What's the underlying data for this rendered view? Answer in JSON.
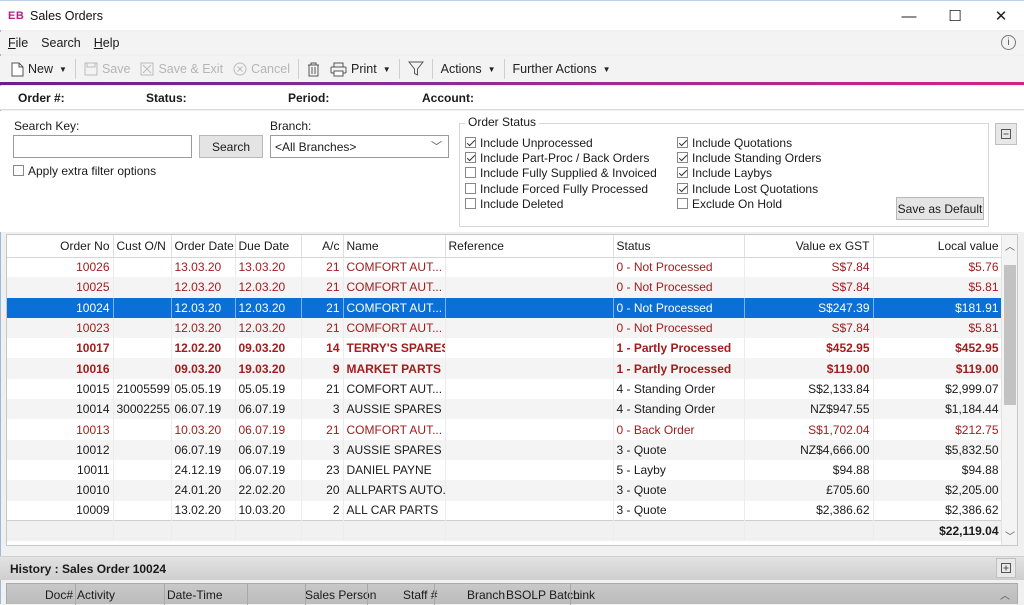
{
  "window": {
    "logo": "EB",
    "title": "Sales Orders",
    "controls": {
      "minimize": "—",
      "maximize": "☐",
      "close": "✕"
    }
  },
  "menu": {
    "items": [
      {
        "label": "File",
        "accel": "F"
      },
      {
        "label": "Search",
        "accel": ""
      },
      {
        "label": "Help",
        "accel": "H"
      }
    ],
    "info_icon": "i"
  },
  "toolbar": {
    "new_label": "New",
    "save_label": "Save",
    "save_exit_label": "Save & Exit",
    "cancel_label": "Cancel",
    "print_label": "Print",
    "actions_label": "Actions",
    "further_actions_label": "Further Actions"
  },
  "header_fields": {
    "order_no": "Order #:",
    "status": "Status:",
    "period": "Period:",
    "account": "Account:"
  },
  "filters": {
    "search_key_label": "Search Key:",
    "search_key_value": "",
    "search_button": "Search",
    "branch_label": "Branch:",
    "branch_value": "<All Branches>",
    "apply_extra_label": "Apply extra filter options",
    "apply_extra_checked": false,
    "order_status_title": "Order Status",
    "save_default_button": "Save as Default",
    "status_options_left": [
      {
        "label": "Include Unprocessed",
        "checked": true
      },
      {
        "label": "Include Part-Proc / Back Orders",
        "checked": true
      },
      {
        "label": "Include Fully Supplied & Invoiced",
        "checked": false
      },
      {
        "label": "Include Forced Fully Processed",
        "checked": false
      },
      {
        "label": "Include Deleted",
        "checked": false
      }
    ],
    "status_options_right": [
      {
        "label": "Include Quotations",
        "checked": true
      },
      {
        "label": "Include Standing Orders",
        "checked": true
      },
      {
        "label": "Include Laybys",
        "checked": true
      },
      {
        "label": "Include Lost Quotations",
        "checked": true
      },
      {
        "label": "Exclude On Hold",
        "checked": false
      }
    ]
  },
  "grid": {
    "columns": [
      "Order No",
      "Cust O/N",
      "Order Date",
      "Due Date",
      "A/c",
      "Name",
      "Reference",
      "Status",
      "Value ex GST",
      "Local value"
    ],
    "rows": [
      {
        "order_no": "10026",
        "cust_on": "",
        "order_date": "13.03.20",
        "due_date": "13.03.20",
        "ac": "21",
        "name": "COMFORT AUT...",
        "reference": "",
        "status": "0 - Not Processed",
        "value_ex_gst": "S$7.84",
        "local_value": "$5.76",
        "style": "red"
      },
      {
        "order_no": "10025",
        "cust_on": "",
        "order_date": "12.03.20",
        "due_date": "12.03.20",
        "ac": "21",
        "name": "COMFORT AUT...",
        "reference": "",
        "status": "0 - Not Processed",
        "value_ex_gst": "S$7.84",
        "local_value": "$5.81",
        "style": "red"
      },
      {
        "order_no": "10024",
        "cust_on": "",
        "order_date": "12.03.20",
        "due_date": "12.03.20",
        "ac": "21",
        "name": "COMFORT AUT...",
        "reference": "",
        "status": "0 - Not Processed",
        "value_ex_gst": "S$247.39",
        "local_value": "$181.91",
        "style": "sel"
      },
      {
        "order_no": "10023",
        "cust_on": "",
        "order_date": "12.03.20",
        "due_date": "12.03.20",
        "ac": "21",
        "name": "COMFORT AUT...",
        "reference": "",
        "status": "0 - Not Processed",
        "value_ex_gst": "S$7.84",
        "local_value": "$5.81",
        "style": "red"
      },
      {
        "order_no": "10017",
        "cust_on": "",
        "order_date": "12.02.20",
        "due_date": "09.03.20",
        "ac": "14",
        "name": "TERRY'S SPARES",
        "reference": "",
        "status": "1 - Partly Processed",
        "value_ex_gst": "$452.95",
        "local_value": "$452.95",
        "style": "bold"
      },
      {
        "order_no": "10016",
        "cust_on": "",
        "order_date": "09.03.20",
        "due_date": "19.03.20",
        "ac": "9",
        "name": "MARKET PARTS",
        "reference": "",
        "status": "1 - Partly Processed",
        "value_ex_gst": "$119.00",
        "local_value": "$119.00",
        "style": "bold"
      },
      {
        "order_no": "10015",
        "cust_on": "21005599",
        "order_date": "05.05.19",
        "due_date": "05.05.19",
        "ac": "21",
        "name": "COMFORT AUT...",
        "reference": "",
        "status": "4 - Standing Order",
        "value_ex_gst": "S$2,133.84",
        "local_value": "$2,999.07",
        "style": "normal"
      },
      {
        "order_no": "10014",
        "cust_on": "30002255",
        "order_date": "06.07.19",
        "due_date": "06.07.19",
        "ac": "3",
        "name": "AUSSIE SPARES",
        "reference": "",
        "status": "4 - Standing Order",
        "value_ex_gst": "NZ$947.55",
        "local_value": "$1,184.44",
        "style": "normal"
      },
      {
        "order_no": "10013",
        "cust_on": "",
        "order_date": "10.03.20",
        "due_date": "06.07.19",
        "ac": "21",
        "name": "COMFORT AUT...",
        "reference": "",
        "status": "0 - Back Order",
        "value_ex_gst": "S$1,702.04",
        "local_value": "$212.75",
        "style": "red"
      },
      {
        "order_no": "10012",
        "cust_on": "",
        "order_date": "06.07.19",
        "due_date": "06.07.19",
        "ac": "3",
        "name": "AUSSIE SPARES",
        "reference": "",
        "status": "3 - Quote",
        "value_ex_gst": "NZ$4,666.00",
        "local_value": "$5,832.50",
        "style": "normal"
      },
      {
        "order_no": "10011",
        "cust_on": "",
        "order_date": "24.12.19",
        "due_date": "06.07.19",
        "ac": "23",
        "name": "DANIEL PAYNE",
        "reference": "",
        "status": "5 - Layby",
        "value_ex_gst": "$94.88",
        "local_value": "$94.88",
        "style": "normal"
      },
      {
        "order_no": "10010",
        "cust_on": "",
        "order_date": "24.01.20",
        "due_date": "22.02.20",
        "ac": "20",
        "name": "ALLPARTS AUTO...",
        "reference": "",
        "status": "3 - Quote",
        "value_ex_gst": "£705.60",
        "local_value": "$2,205.00",
        "style": "normal"
      },
      {
        "order_no": "10009",
        "cust_on": "",
        "order_date": "13.02.20",
        "due_date": "10.03.20",
        "ac": "2",
        "name": "ALL CAR PARTS",
        "reference": "",
        "status": "3 - Quote",
        "value_ex_gst": "$2,386.62",
        "local_value": "$2,386.62",
        "style": "normal"
      }
    ],
    "total_local_value": "$22,119.04"
  },
  "history": {
    "title": "History : Sales Order 10024",
    "columns": [
      "Doc#",
      "Activity",
      "Date-Time",
      "Sales Person",
      "Staff #",
      "Branch",
      "BSOLP Batch",
      "Link"
    ]
  },
  "colors": {
    "accent_start": "#6a1f8c",
    "accent_end": "#d3247e",
    "selection": "#0a6fd6",
    "alert_text": "#a11d1d"
  }
}
